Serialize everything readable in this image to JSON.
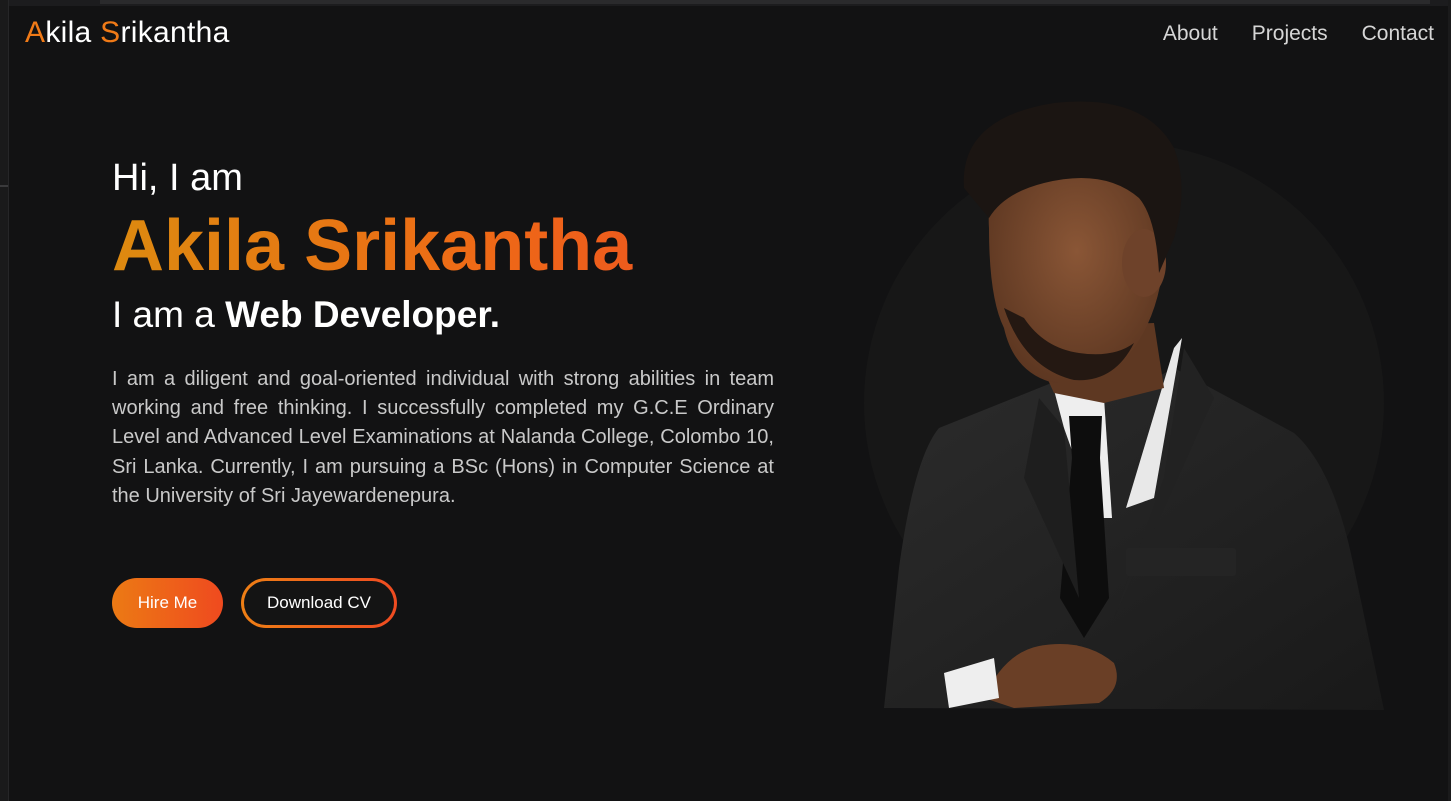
{
  "header": {
    "logo_initial_1": "A",
    "logo_rest_1": "kila ",
    "logo_initial_2": "S",
    "logo_rest_2": "rikantha",
    "nav": [
      {
        "label": "About"
      },
      {
        "label": "Projects"
      },
      {
        "label": "Contact"
      }
    ]
  },
  "hero": {
    "greeting": "Hi, I am",
    "name": "Akila Srikantha",
    "role_prefix": "I am a ",
    "role_highlight": "Web Developer.",
    "bio": "I am a diligent and goal-oriented individual with strong abilities in team working and free thinking. I successfully completed my G.C.E Ordinary Level and Advanced Level Examinations at Nalanda College, Colombo 10, Sri Lanka. Currently, I am pursuing a BSc (Hons) in Computer Science at the University of Sri Jayewardenepura.",
    "hire_button": "Hire Me",
    "cv_button": "Download CV"
  },
  "colors": {
    "background": "#121213",
    "accent_orange": "#f07a17",
    "accent_red": "#ef4a1f",
    "text_muted": "#c9c9c9"
  }
}
